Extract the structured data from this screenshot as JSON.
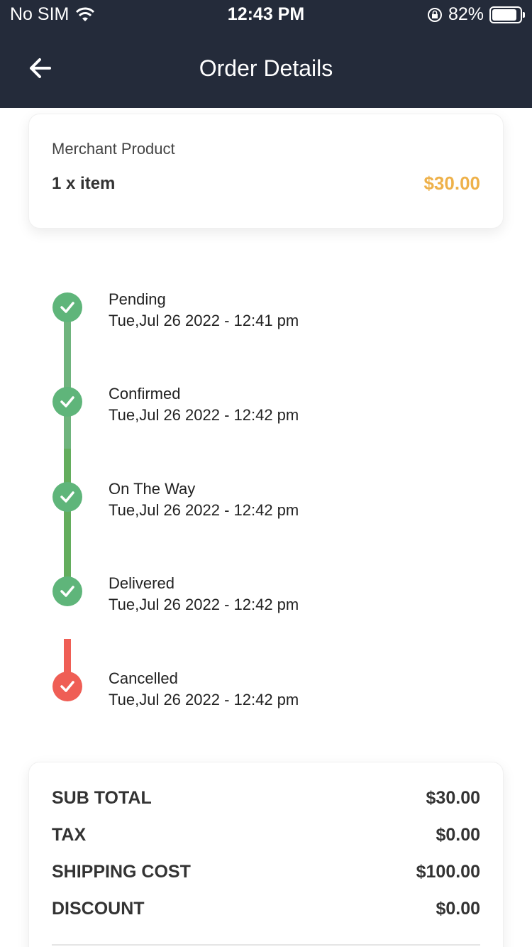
{
  "status_bar": {
    "carrier": "No SIM",
    "time": "12:43 PM",
    "battery": "82%"
  },
  "header": {
    "title": "Order Details"
  },
  "product": {
    "label": "Merchant Product",
    "quantity": "1 x item",
    "price": "$30.00"
  },
  "timeline": [
    {
      "status": "Pending",
      "datetime": "Tue,Jul 26 2022 - 12:41 pm"
    },
    {
      "status": "Confirmed",
      "datetime": "Tue,Jul 26 2022 - 12:42 pm"
    },
    {
      "status": "On The Way",
      "datetime": "Tue,Jul 26 2022 - 12:42 pm"
    },
    {
      "status": "Delivered",
      "datetime": "Tue,Jul 26 2022 - 12:42 pm"
    },
    {
      "status": "Cancelled",
      "datetime": "Tue,Jul 26 2022 - 12:42 pm"
    }
  ],
  "summary": {
    "subtotal_label": "SUB TOTAL",
    "subtotal_value": "$30.00",
    "tax_label": "TAX",
    "tax_value": "$0.00",
    "shipping_label": "SHIPPING COST",
    "shipping_value": "$100.00",
    "discount_label": "DISCOUNT",
    "discount_value": "$0.00"
  },
  "colors": {
    "header_bg": "#242b3a",
    "price": "#eeb14a",
    "step_done": "#5fb57a",
    "step_cancel": "#ef5e55"
  }
}
